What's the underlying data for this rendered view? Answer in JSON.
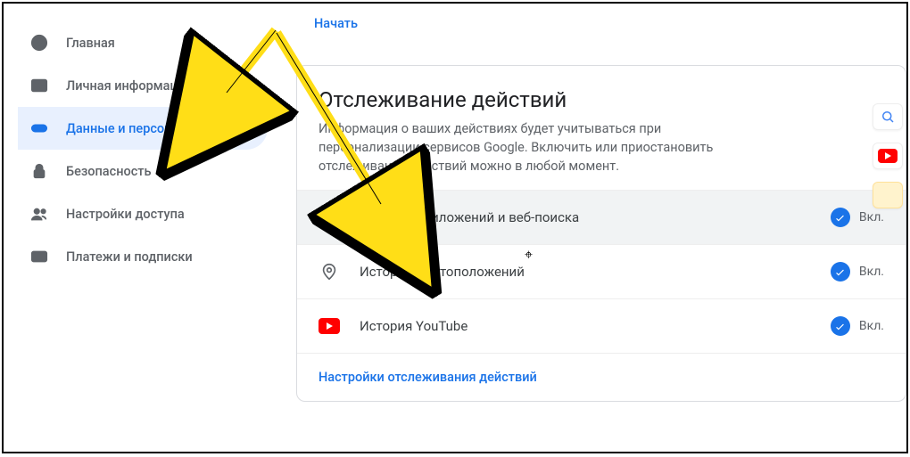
{
  "sidebar": {
    "items": [
      {
        "label": "Главная",
        "icon": "home",
        "active": false
      },
      {
        "label": "Личная информация",
        "icon": "id-card",
        "active": false
      },
      {
        "label": "Данные и персонализация",
        "icon": "toggle",
        "active": true
      },
      {
        "label": "Безопасность",
        "icon": "lock",
        "active": false
      },
      {
        "label": "Настройки доступа",
        "icon": "people",
        "active": false
      },
      {
        "label": "Платежи и подписки",
        "icon": "card",
        "active": false
      }
    ]
  },
  "top_link": "Начать",
  "card": {
    "title": "Отслеживание действий",
    "description": "Информация о ваших действиях будет учитываться при персонализации сервисов Google. Включить или приостановить отслеживание действий можно в любой момент.",
    "rows": [
      {
        "label": "История приложений и веб-поиска",
        "status": "Вкл.",
        "highlight": true
      },
      {
        "label": "История местоположений",
        "status": "Вкл.",
        "highlight": false
      },
      {
        "label": "История YouTube",
        "status": "Вкл.",
        "highlight": false
      }
    ],
    "footer_link": "Настройки отслеживания действий"
  }
}
